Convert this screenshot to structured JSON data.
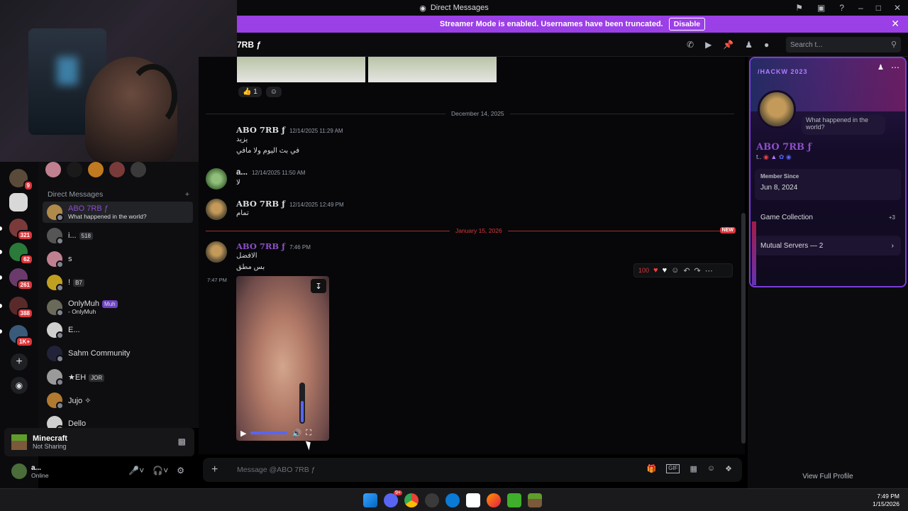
{
  "titlebar": {
    "title": "Direct Messages"
  },
  "banner": {
    "text": "Streamer Mode is enabled. Usernames have been truncated.",
    "disable": "Disable"
  },
  "rail": {
    "badges": [
      "9",
      "321",
      "62",
      "261",
      "388",
      "1K+"
    ]
  },
  "dm": {
    "header": "Direct Messages",
    "items": [
      {
        "name": "ABO 7RB ƒ",
        "sub": "What happened in the world?"
      },
      {
        "name": "i...",
        "tag": "518"
      },
      {
        "name": "s"
      },
      {
        "name": "!",
        "tag": "B7"
      },
      {
        "name": "OnlyMuh",
        "tag": "Muh",
        "sub": "- OnlyMuh"
      },
      {
        "name": "E..."
      },
      {
        "name": "Sahm Community"
      },
      {
        "name": "★EH",
        "tag": "JOR"
      },
      {
        "name": "Jujo ✧"
      },
      {
        "name": "Dello"
      }
    ]
  },
  "activity": {
    "title": "Minecraft",
    "sub": "Not Sharing"
  },
  "user": {
    "name": "a...",
    "status": "Online"
  },
  "chat": {
    "name": "7RB ƒ",
    "search_placeholder": "Search t...",
    "reaction_count": "1",
    "dates": {
      "d1": "December 14, 2025",
      "d2": "January 15, 2026",
      "new": "NEW"
    },
    "messages": [
      {
        "author": "ABO 7RB ƒ",
        "ts": "12/14/2025 11:29 AM",
        "lines": [
          "يزيد",
          "في بث اليوم ولا مافي"
        ]
      },
      {
        "author": "a...",
        "ts": "12/14/2025 11:50 AM",
        "lines": [
          "لا"
        ]
      },
      {
        "author": "ABO 7RB ƒ",
        "ts": "12/14/2025 12:49 PM",
        "lines": [
          "تمام"
        ]
      },
      {
        "author": "ABO 7RB ƒ",
        "ts": "7:46 PM",
        "lines": [
          "الافضل",
          "بس مطق"
        ]
      }
    ],
    "side_ts": "7:47 PM",
    "composer_placeholder": "Message @ABO 7RB ƒ"
  },
  "profile": {
    "banner_text": "/HACKW 2023",
    "note": "What happened in the world?",
    "name": "ABO 7RB ƒ",
    "member_since_label": "Member Since",
    "member_since": "Jun 8, 2024",
    "game_collection": "Game Collection",
    "game_more": "+3",
    "mutual_servers": "Mutual Servers — 2",
    "view_full": "View Full Profile"
  },
  "taskbar": {
    "time": "7:49 PM",
    "date": "1/15/2026",
    "discord_badge": "9+"
  },
  "colors": {
    "accent": "#9b3fe6",
    "brand": "#5865f2",
    "danger": "#da373c",
    "name_purple": "#8c4fc8"
  }
}
